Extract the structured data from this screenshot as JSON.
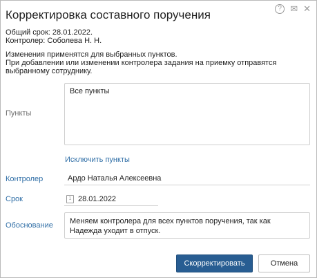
{
  "dialog": {
    "title": "Корректировка составного поручения",
    "summary": {
      "deadline": "Общий срок: 28.01.2022.",
      "controller": "Контролер: Соболева Н. Н."
    },
    "notice": {
      "line1": "Изменения применятся для выбранных пунктов.",
      "line2": "При добавлении или изменении контролера задания на приемку отправятся выбранному сотруднику."
    }
  },
  "icons": {
    "help": "question-icon",
    "mail": "mail-icon",
    "close": "close-icon"
  },
  "form": {
    "points_label": "Пункты",
    "points_value": "Все пункты",
    "exclude_link": "Исключить пункты",
    "controller_label": "Контролер",
    "controller_value": "Ардо Наталья Алексеевна",
    "deadline_label": "Срок",
    "deadline_value": "28.01.2022",
    "reason_label": "Обоснование",
    "reason_value": "Меняем контролера для всех пунктов поручения, так как Надежда уходит в отпуск."
  },
  "buttons": {
    "submit": "Скорректировать",
    "cancel": "Отмена"
  },
  "colors": {
    "accent": "#285d92",
    "link": "#2f6ea6"
  }
}
